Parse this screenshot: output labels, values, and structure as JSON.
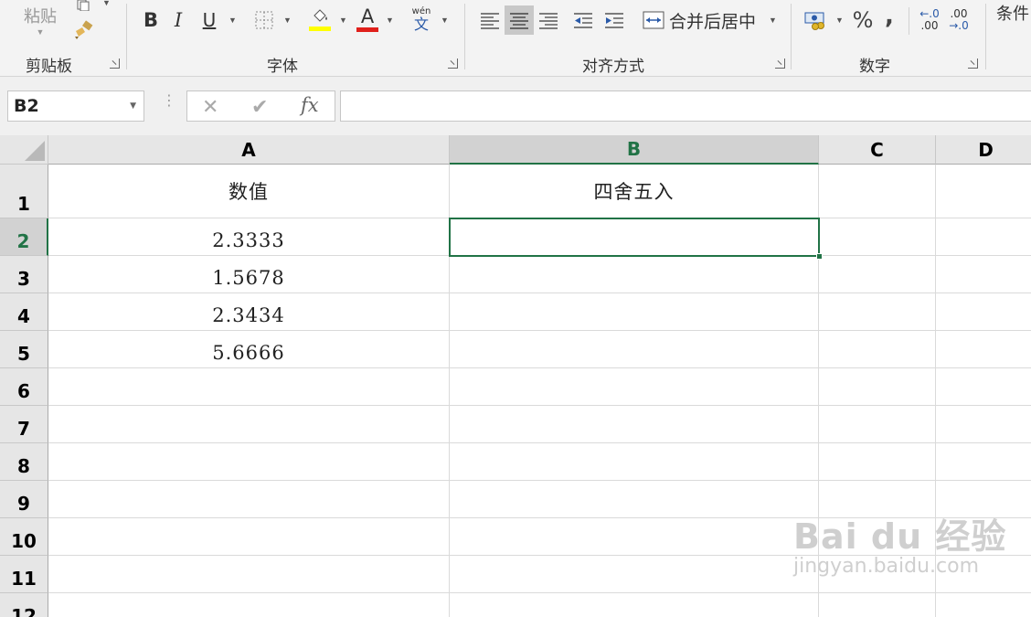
{
  "ribbon": {
    "clipboard": {
      "paste_label": "粘贴",
      "group_label": "剪贴板"
    },
    "font": {
      "bold": "B",
      "italic": "I",
      "underline": "U",
      "font_color_glyph": "A",
      "wen_top": "wén",
      "wen_bottom": "文",
      "group_label": "字体",
      "fill_color": "#ffff00",
      "font_color": "#e0201b"
    },
    "alignment": {
      "merge_label": "合并后居中",
      "group_label": "对齐方式"
    },
    "number": {
      "percent": "%",
      "comma": ",",
      "inc_decimal_top": "←.0",
      "inc_decimal_bottom": ".00",
      "dec_decimal_top": ".00",
      "dec_decimal_bottom": "→.0",
      "group_label": "数字"
    },
    "styles": {
      "conditional_label": "条件"
    }
  },
  "formula_bar": {
    "name_box": "B2",
    "fx_label": "fx",
    "value": ""
  },
  "sheet": {
    "columns": [
      "A",
      "B",
      "C",
      "D"
    ],
    "rows": [
      "1",
      "2",
      "3",
      "4",
      "5",
      "6",
      "7",
      "8",
      "9",
      "10",
      "11",
      "12"
    ],
    "cells": {
      "A1": "数值",
      "B1": "四舍五入",
      "A2": "2.3333",
      "A3": "1.5678",
      "A4": "2.3434",
      "A5": "5.6666"
    },
    "active_cell": "B2",
    "accent": "#217346"
  },
  "watermark": {
    "main": "Bai du 经验",
    "sub": "jingyan.baidu.com"
  }
}
